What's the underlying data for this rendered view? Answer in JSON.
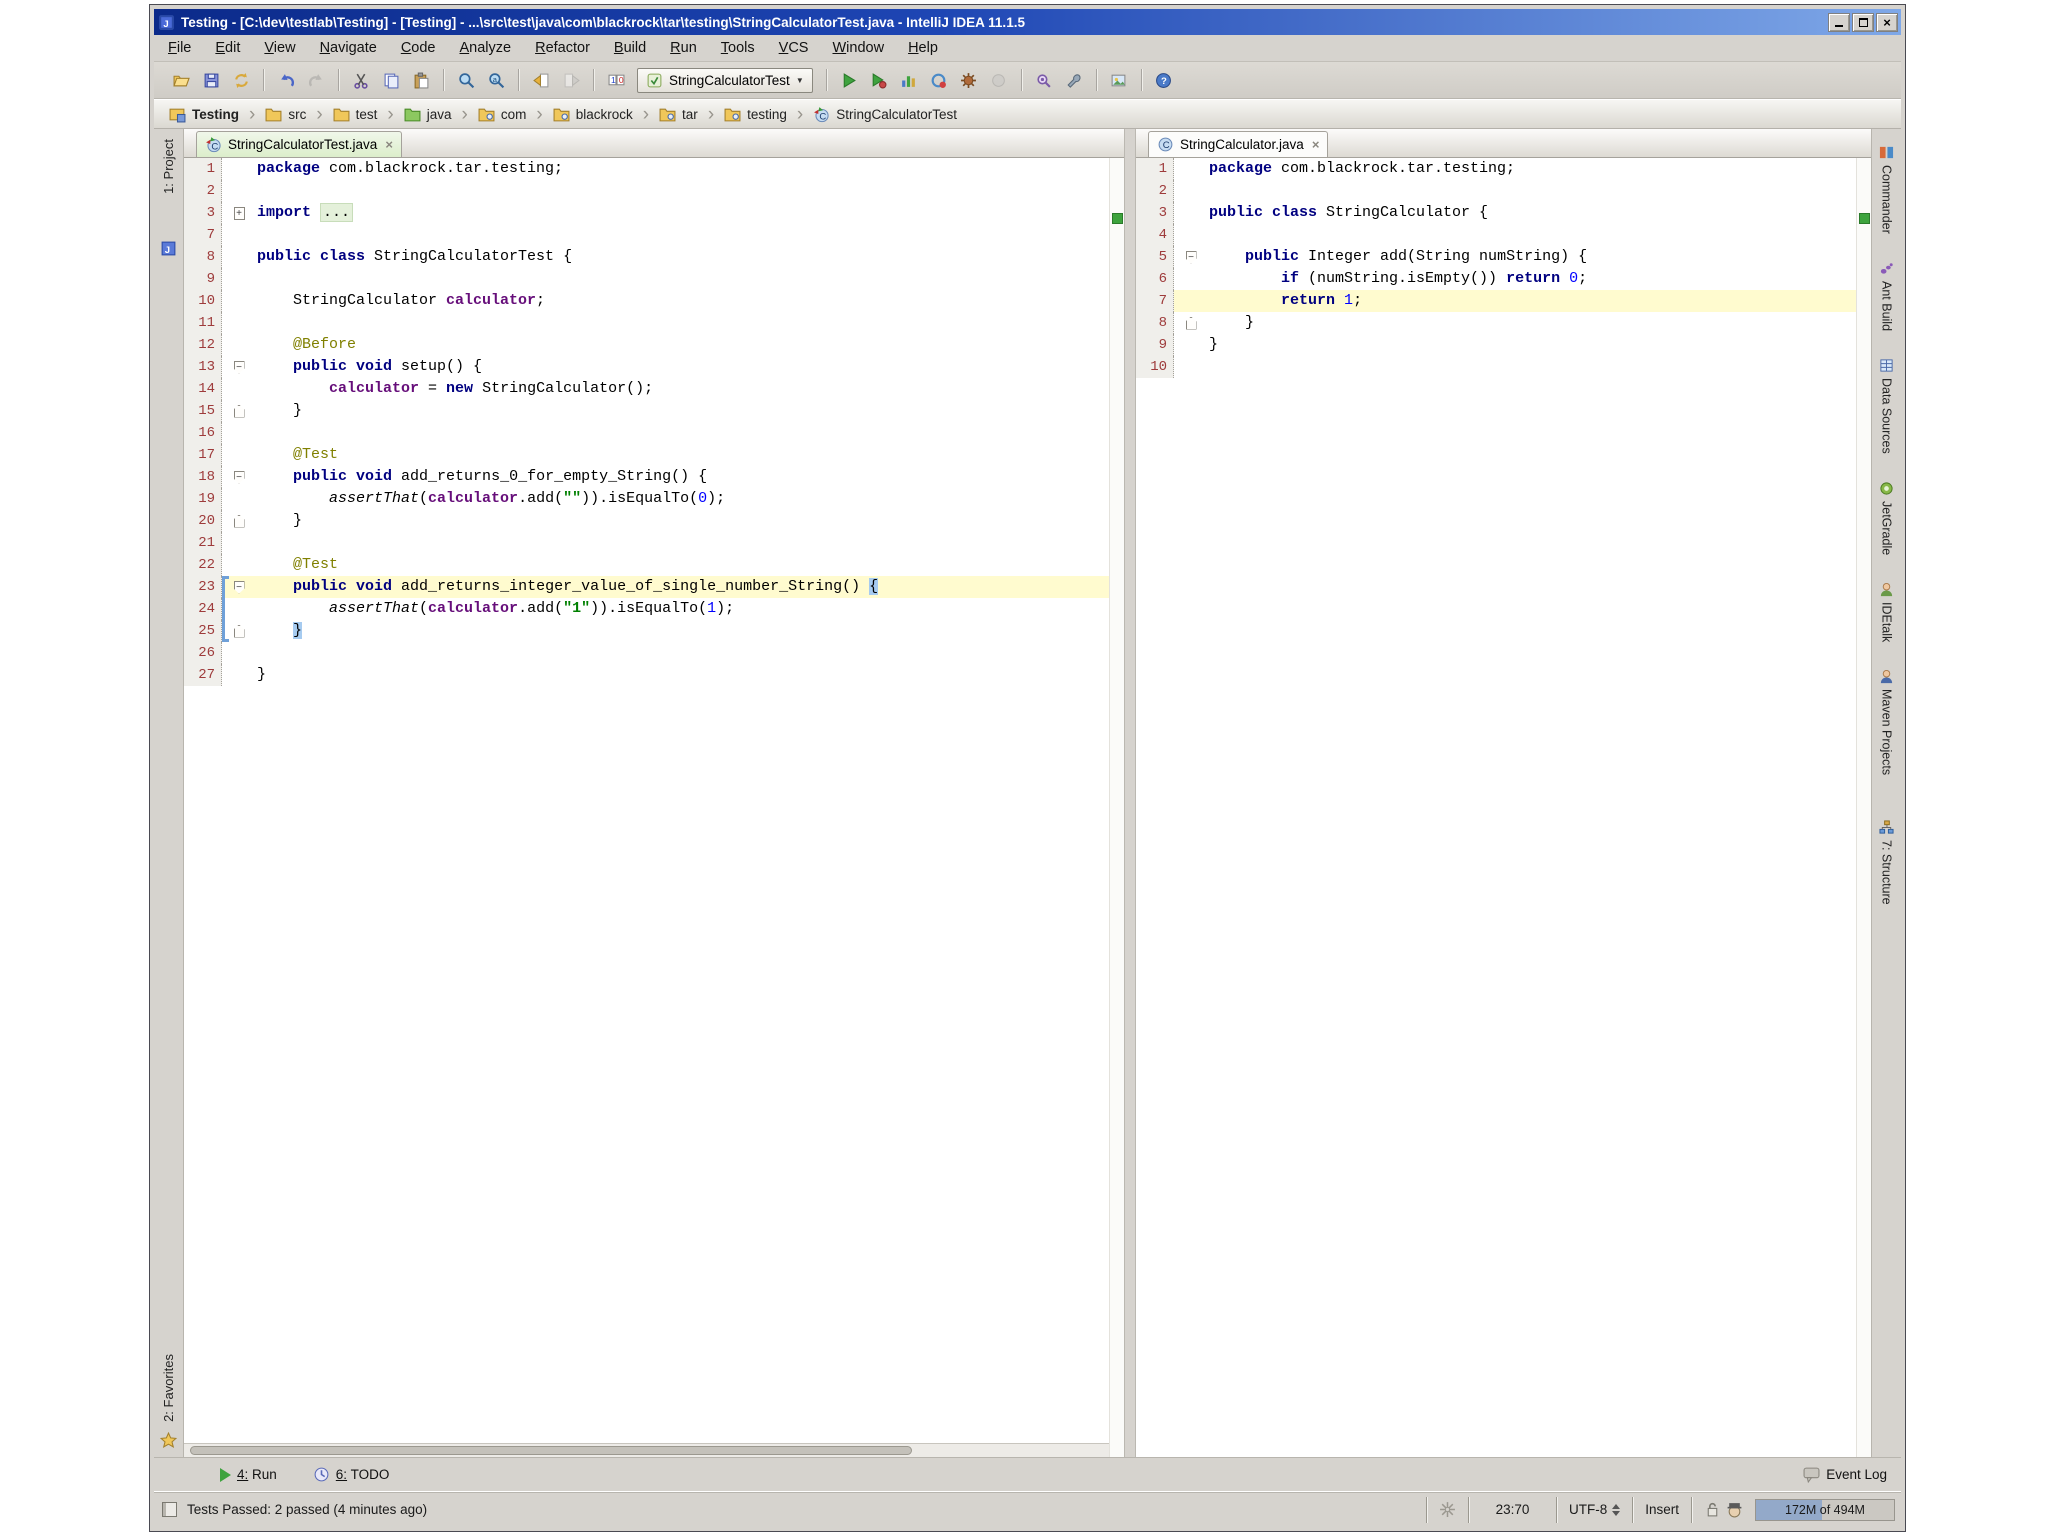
{
  "window": {
    "title": "Testing - [C:\\dev\\testlab\\Testing] - [Testing] - ...\\src\\test\\java\\com\\blackrock\\tar\\testing\\StringCalculatorTest.java - IntelliJ IDEA 11.1.5"
  },
  "glyphs": {
    "close": "×",
    "crumb_sep": "›",
    "combo_arrow": "▼"
  },
  "menu": [
    "File",
    "Edit",
    "View",
    "Navigate",
    "Code",
    "Analyze",
    "Refactor",
    "Build",
    "Run",
    "Tools",
    "VCS",
    "Window",
    "Help"
  ],
  "toolbar": {
    "run_config": "StringCalculatorTest",
    "groups": [
      [
        "open",
        "save-all",
        "synchronize"
      ],
      [
        "undo",
        "redo:d"
      ],
      [
        "cut",
        "copy",
        "paste"
      ],
      [
        "find",
        "replace"
      ],
      [
        "back",
        "forward:d"
      ],
      [
        "numbers"
      ],
      [
        "run",
        "debug",
        "coverage",
        "rerun",
        "settings-gear",
        "stop:d"
      ],
      [
        "inspect",
        "wrench"
      ],
      [
        "screenshot"
      ],
      [
        "help"
      ]
    ]
  },
  "breadcrumbs": [
    {
      "label": "Testing",
      "icon": "project"
    },
    {
      "label": "src",
      "icon": "folder"
    },
    {
      "label": "test",
      "icon": "folder"
    },
    {
      "label": "java",
      "icon": "folder-green"
    },
    {
      "label": "com",
      "icon": "package"
    },
    {
      "label": "blackrock",
      "icon": "package"
    },
    {
      "label": "tar",
      "icon": "package"
    },
    {
      "label": "testing",
      "icon": "package"
    },
    {
      "label": "StringCalculatorTest",
      "icon": "test-class"
    }
  ],
  "left_stripe": {
    "project": "1: Project",
    "favorites": "2: Favorites"
  },
  "right_stripe": [
    {
      "label": "Commander",
      "icon": "commander"
    },
    {
      "label": "Ant Build",
      "icon": "ant-build"
    },
    {
      "label": "Data Sources",
      "icon": "data-sources"
    },
    {
      "label": "JetGradle",
      "icon": "jetgradle"
    },
    {
      "label": "IDEtalk",
      "icon": "idetalk"
    },
    {
      "label": "Maven Projects",
      "icon": "maven-projects"
    },
    {
      "label": "7: Structure",
      "icon": "structure"
    }
  ],
  "editors": {
    "left": {
      "tab": "StringCalculatorTest.java",
      "tab_icon": "test-class",
      "lines": [
        {
          "n": "1",
          "seg": [
            [
              "k",
              "package"
            ],
            [
              "p",
              " com.blackrock.tar.testing;"
            ]
          ]
        },
        {
          "n": "2",
          "seg": []
        },
        {
          "n": "3",
          "fold": "plus",
          "seg": [
            [
              "k",
              "import"
            ],
            [
              "p",
              " "
            ],
            [
              "fold",
              "..."
            ]
          ]
        },
        {
          "n": "7",
          "seg": []
        },
        {
          "n": "8",
          "seg": [
            [
              "k",
              "public class"
            ],
            [
              "p",
              " StringCalculatorTest {"
            ]
          ]
        },
        {
          "n": "9",
          "seg": []
        },
        {
          "n": "10",
          "seg": [
            [
              "p",
              "    StringCalculator "
            ],
            [
              "f",
              "calculator"
            ],
            [
              "p",
              ";"
            ]
          ]
        },
        {
          "n": "11",
          "seg": []
        },
        {
          "n": "12",
          "seg": [
            [
              "a",
              "    @Before"
            ]
          ]
        },
        {
          "n": "13",
          "fold": "open",
          "seg": [
            [
              "p",
              "    "
            ],
            [
              "k",
              "public void"
            ],
            [
              "p",
              " setup() {"
            ]
          ]
        },
        {
          "n": "14",
          "seg": [
            [
              "p",
              "        "
            ],
            [
              "f",
              "calculator"
            ],
            [
              "p",
              " = "
            ],
            [
              "k",
              "new"
            ],
            [
              "p",
              " StringCalculator();"
            ]
          ]
        },
        {
          "n": "15",
          "fold": "end",
          "seg": [
            [
              "p",
              "    }"
            ]
          ]
        },
        {
          "n": "16",
          "seg": []
        },
        {
          "n": "17",
          "seg": [
            [
              "a",
              "    @Test"
            ]
          ]
        },
        {
          "n": "18",
          "fold": "open",
          "seg": [
            [
              "p",
              "    "
            ],
            [
              "k",
              "public void"
            ],
            [
              "p",
              " add_returns_0_for_empty_String() {"
            ]
          ]
        },
        {
          "n": "19",
          "seg": [
            [
              "p",
              "        "
            ],
            [
              "i",
              "assertThat"
            ],
            [
              "p",
              "("
            ],
            [
              "f",
              "calculator"
            ],
            [
              "p",
              ".add("
            ],
            [
              "s",
              "\"\""
            ],
            [
              "p",
              ")).isEqualTo("
            ],
            [
              "n2",
              "0"
            ],
            [
              "p",
              ");"
            ]
          ]
        },
        {
          "n": "20",
          "fold": "end",
          "seg": [
            [
              "p",
              "    }"
            ]
          ]
        },
        {
          "n": "21",
          "seg": []
        },
        {
          "n": "22",
          "seg": [
            [
              "a",
              "    @Test"
            ]
          ]
        },
        {
          "n": "23",
          "fold": "open",
          "hl": true,
          "br": "s",
          "seg": [
            [
              "p",
              "    "
            ],
            [
              "k",
              "public void"
            ],
            [
              "p",
              " add_returns_integer_value_of_single_number_String() "
            ],
            [
              "bh",
              "{"
            ]
          ]
        },
        {
          "n": "24",
          "br": "m",
          "seg": [
            [
              "p",
              "        "
            ],
            [
              "i",
              "assertThat"
            ],
            [
              "p",
              "("
            ],
            [
              "f",
              "calculator"
            ],
            [
              "p",
              ".add("
            ],
            [
              "s",
              "\"1\""
            ],
            [
              "p",
              ")).isEqualTo("
            ],
            [
              "n2",
              "1"
            ],
            [
              "p",
              ");"
            ]
          ]
        },
        {
          "n": "25",
          "fold": "end",
          "br": "e",
          "seg": [
            [
              "p",
              "    "
            ],
            [
              "bh",
              "}"
            ]
          ]
        },
        {
          "n": "26",
          "seg": []
        },
        {
          "n": "27",
          "seg": [
            [
              "p",
              "}"
            ]
          ]
        }
      ]
    },
    "right": {
      "tab": "StringCalculator.java",
      "tab_icon": "class",
      "lines": [
        {
          "n": "1",
          "seg": [
            [
              "k",
              "package"
            ],
            [
              "p",
              " com.blackrock.tar.testing;"
            ]
          ]
        },
        {
          "n": "2",
          "seg": []
        },
        {
          "n": "3",
          "seg": [
            [
              "k",
              "public class"
            ],
            [
              "p",
              " StringCalculator {"
            ]
          ]
        },
        {
          "n": "4",
          "seg": []
        },
        {
          "n": "5",
          "fold": "open",
          "seg": [
            [
              "p",
              "    "
            ],
            [
              "k",
              "public"
            ],
            [
              "p",
              " Integer add(String numString) {"
            ]
          ]
        },
        {
          "n": "6",
          "seg": [
            [
              "p",
              "        "
            ],
            [
              "k",
              "if"
            ],
            [
              "p",
              " (numString.isEmpty()) "
            ],
            [
              "k",
              "return"
            ],
            [
              "p",
              " "
            ],
            [
              "n2",
              "0"
            ],
            [
              "p",
              ";"
            ]
          ]
        },
        {
          "n": "7",
          "hl": true,
          "seg": [
            [
              "p",
              "        "
            ],
            [
              "k",
              "return"
            ],
            [
              "p",
              " "
            ],
            [
              "n2",
              "1"
            ],
            [
              "p",
              ";"
            ]
          ]
        },
        {
          "n": "8",
          "fold": "end",
          "seg": [
            [
              "p",
              "    }"
            ]
          ]
        },
        {
          "n": "9",
          "seg": [
            [
              "p",
              "}"
            ]
          ]
        },
        {
          "n": "10",
          "seg": []
        }
      ]
    }
  },
  "bottom_bar": {
    "run": "4: Run",
    "todo": "6: TODO",
    "event_log": "Event Log"
  },
  "status_bar": {
    "message": "Tests Passed: 2 passed (4 minutes ago)",
    "position": "23:70",
    "encoding": "UTF-8",
    "mode": "Insert",
    "memory": "172M of 494M"
  },
  "colors": {
    "keyword": "#000080",
    "annotation": "#808000",
    "field": "#660E7A",
    "string": "#008000",
    "number": "#0000FF",
    "current_line": "#FFFBCF",
    "ok_mark": "#3DA33D",
    "title_bar": "#0B2A8A",
    "chrome": "#D6D3CE"
  }
}
